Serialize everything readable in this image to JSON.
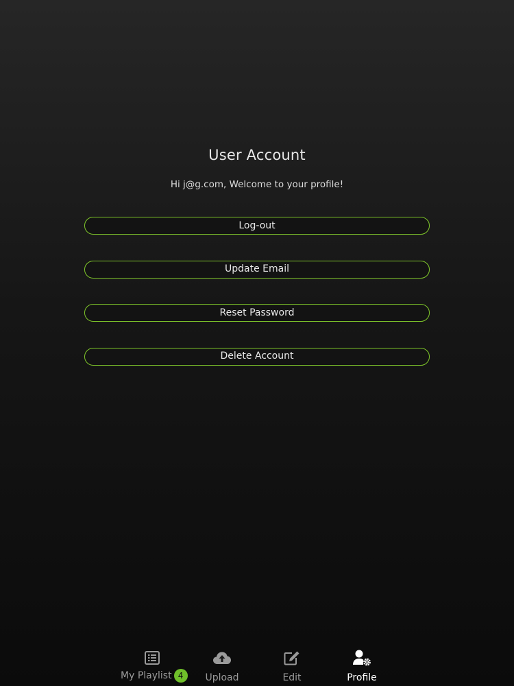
{
  "header": {
    "title": "User Account",
    "welcome": "Hi j@g.com, Welcome to your profile!"
  },
  "actions": [
    {
      "label": "Log-out"
    },
    {
      "label": "Update Email"
    },
    {
      "label": "Reset Password"
    },
    {
      "label": "Delete Account"
    }
  ],
  "tabbar": {
    "tabs": [
      {
        "label": "My Playlist",
        "icon": "list-icon",
        "badge": "4"
      },
      {
        "label": "Upload",
        "icon": "cloud-upload-icon"
      },
      {
        "label": "Edit",
        "icon": "edit-icon"
      },
      {
        "label": "Profile",
        "icon": "user-cog-icon",
        "active": true
      }
    ]
  },
  "colors": {
    "accent": "#7fc72a",
    "badge": "#6fbf2a",
    "tab_inactive": "#9a9a9a",
    "tab_active": "#ffffff"
  }
}
